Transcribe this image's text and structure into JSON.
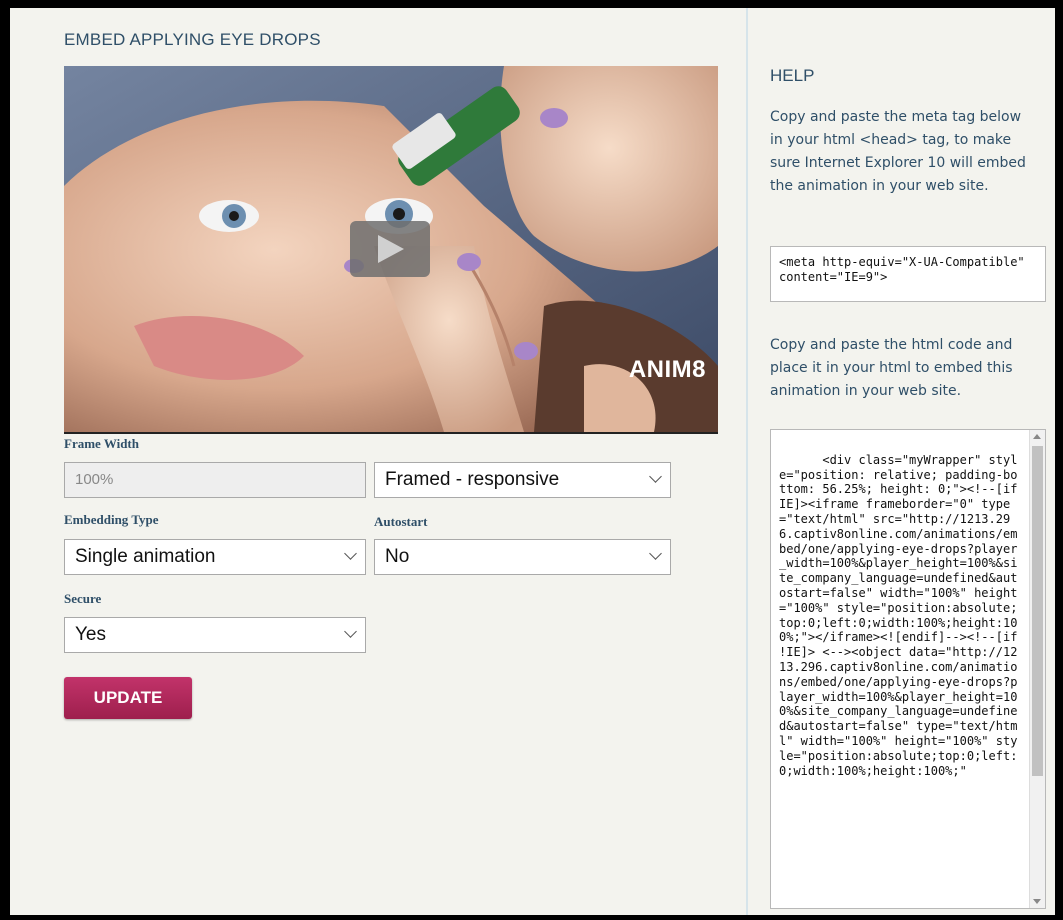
{
  "page": {
    "title": "EMBED APPLYING EYE DROPS",
    "video_logo": "ANIM8"
  },
  "form": {
    "frame_width_label": "Frame Width",
    "frame_width_value": "100%",
    "frame_mode_value": "Framed - responsive",
    "embedding_type_label": "Embedding Type",
    "embedding_type_value": "Single animation",
    "autostart_label": "Autostart",
    "autostart_value": "No",
    "secure_label": "Secure",
    "secure_value": "Yes",
    "update_label": "UPDATE"
  },
  "help": {
    "title": "HELP",
    "text1": "Copy and paste the meta tag below in your html <head> tag, to make sure Internet Explorer 10 will embed the animation in your web site.",
    "meta_code": "<meta http-equiv=\"X-UA-Compatible\" content=\"IE=9\">",
    "text2": "Copy and paste the html code and place it in your html to embed this animation in your web site.",
    "embed_code": "<div class=\"myWrapper\" style=\"position: relative; padding-bottom: 56.25%; height: 0;\"><!--[if IE]><iframe frameborder=\"0\" type=\"text/html\" src=\"http://1213.296.captiv8online.com/animations/embed/one/applying-eye-drops?player_width=100%&player_height=100%&site_company_language=undefined&autostart=false\" width=\"100%\" height=\"100%\" style=\"position:absolute;top:0;left:0;width:100%;height:100%;\"></iframe><![endif]--><!--[if !IE]> <--><object data=\"http://1213.296.captiv8online.com/animations/embed/one/applying-eye-drops?player_width=100%&player_height=100%&site_company_language=undefined&autostart=false\" type=\"text/html\" width=\"100%\" height=\"100%\" style=\"position:absolute;top:0;left:0;width:100%;height:100%;\""
  }
}
